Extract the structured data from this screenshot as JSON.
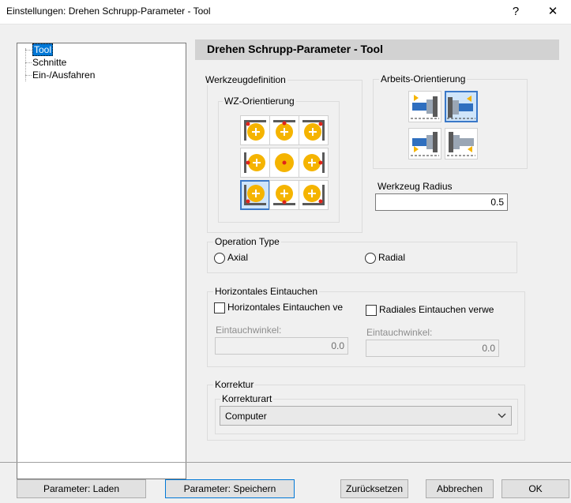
{
  "window": {
    "title": "Einstellungen: Drehen Schrupp-Parameter - Tool",
    "help_glyph": "?",
    "close_glyph": "✕"
  },
  "tree": {
    "items": [
      {
        "label": "Tool",
        "selected": true
      },
      {
        "label": "Schnitte",
        "selected": false
      },
      {
        "label": "Ein-/Ausfahren",
        "selected": false
      }
    ]
  },
  "header": {
    "title": "Drehen Schrupp-Parameter - Tool"
  },
  "werkzeugdefinition": {
    "group_label": "Werkzeugdefinition",
    "wz_orientierung_label": "WZ-Orientierung",
    "selected_index": 6
  },
  "arbeits": {
    "group_label": "Arbeits-Orientierung",
    "selected_index": 1
  },
  "radius": {
    "label": "Werkzeug Radius",
    "value": "0.5"
  },
  "operation": {
    "group_label": "Operation Type",
    "axial_label": "Axial",
    "radial_label": "Radial"
  },
  "eintauchen": {
    "group_label": "Horizontales Eintauchen",
    "horizontal_check_label": "Horizontales Eintauchen ve",
    "radial_check_label": "Radiales Eintauchen verwe",
    "angle_label_left": "Eintauchwinkel:",
    "angle_value_left": "0.0",
    "angle_label_right": "Eintauchwinkel:",
    "angle_value_right": "0.0"
  },
  "korrektur": {
    "group_label": "Korrektur",
    "korrekturart_label": "Korrekturart",
    "selected_value": "Computer"
  },
  "buttons": {
    "laden": "Parameter: Laden",
    "speichern": "Parameter: Speichern",
    "zuruecksetzen": "Zurücksetzen",
    "abbrechen": "Abbrechen",
    "ok": "OK"
  },
  "colors": {
    "accent": "#0078d7",
    "tool_yellow": "#f5b400",
    "tool_red": "#e0241b",
    "holder_gray": "#5a5a5a",
    "spindle_blue": "#2f6fbf"
  }
}
